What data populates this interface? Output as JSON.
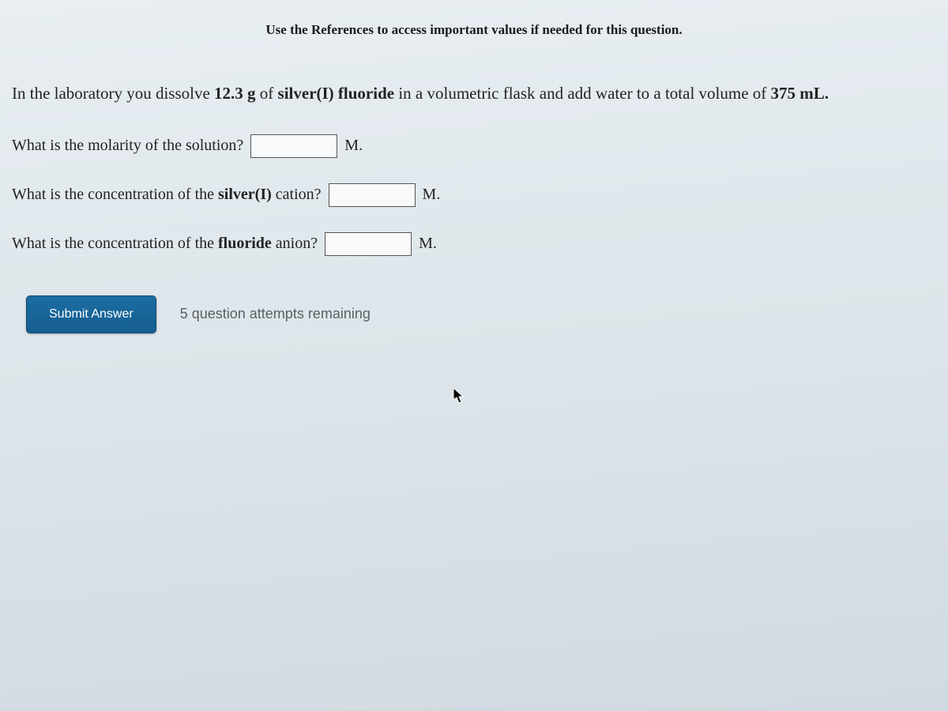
{
  "reference_note": "Use the References to access important values if needed for this question.",
  "problem": {
    "prefix": "In the laboratory you dissolve ",
    "mass": "12.3 g",
    "of": " of ",
    "compound": "silver(I) fluoride",
    "middle": " in a volumetric flask and add water to a total volume of ",
    "volume": "375 mL."
  },
  "questions": {
    "q1": {
      "label": "What is the molarity of the solution?",
      "unit": "M."
    },
    "q2": {
      "prefix": "What is the concentration of the ",
      "bold": "silver(I)",
      "suffix": " cation?",
      "unit": "M."
    },
    "q3": {
      "prefix": "What is the concentration of the ",
      "bold": "fluoride",
      "suffix": " anion?",
      "unit": "M."
    }
  },
  "submit": {
    "button_label": "Submit Answer",
    "attempts": "5 question attempts remaining"
  }
}
